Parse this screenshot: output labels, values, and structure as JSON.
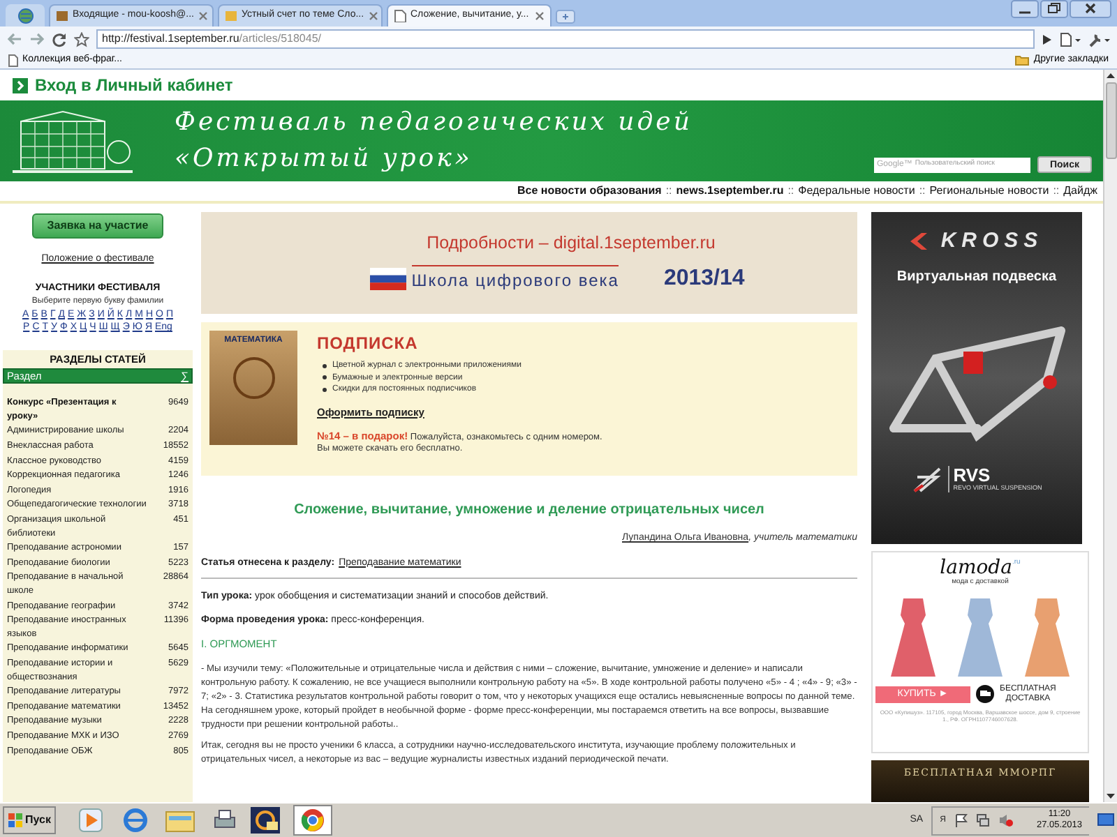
{
  "browser": {
    "tabs": [
      {
        "label": "Входящие - mou-koosh@...",
        "selected": false
      },
      {
        "label": "Устный счет по теме Сло...",
        "selected": false
      },
      {
        "label": "Сложение, вычитание, у...",
        "selected": true
      }
    ],
    "url_host": "http://festival.1september.ru",
    "url_path": "/articles/518045/",
    "bookmarks": [
      "Коллекция веб-фраг..."
    ],
    "other_bookmarks": "Другие закладки"
  },
  "site": {
    "login_link": "Вход в Личный кабинет",
    "title_line_1": "Фестиваль педагогических идей",
    "title_line_2": "«Открытый урок»",
    "search": {
      "brand": "Google™",
      "placeholder": "Пользовательский поиск",
      "button": "Поиск"
    },
    "news_links": [
      {
        "kind": "link",
        "label": "Все новости образования",
        "bold": true
      },
      {
        "kind": "separator",
        "label": "::"
      },
      {
        "kind": "link",
        "label": "news.1september.ru",
        "bold": true
      },
      {
        "kind": "separator",
        "label": "::"
      },
      {
        "kind": "link",
        "label": "Федеральные новости",
        "bold": false
      },
      {
        "kind": "separator",
        "label": "::"
      },
      {
        "kind": "link",
        "label": "Региональные новости",
        "bold": false
      },
      {
        "kind": "separator",
        "label": "::"
      },
      {
        "kind": "link",
        "label": "Дайдж",
        "bold": false
      }
    ]
  },
  "sidebar": {
    "apply_button": "Заявка на участие",
    "rules_link": "Положение о фестивале",
    "participants_title": "УЧАСТНИКИ ФЕСТИВАЛЯ",
    "participants_hint": "Выберите первую букву фамилии",
    "letter_rows": [
      [
        "А",
        "Б",
        "В",
        "Г",
        "Д",
        "Е",
        "Ж",
        "З",
        "И",
        "Й",
        "К",
        "Л",
        "М",
        "Н",
        "О",
        "П"
      ],
      [
        "Р",
        "С",
        "Т",
        "У",
        "Ф",
        "Х",
        "Ц",
        "Ч",
        "Ш",
        "Щ",
        "Э",
        "Ю",
        "Я",
        "Eng"
      ]
    ],
    "sections_title": "РАЗДЕЛЫ СТАТЕЙ",
    "columns": [
      "Раздел",
      "∑"
    ],
    "rows": [
      {
        "name": "Конкурс «Презентация к уроку»",
        "count": "9649",
        "bold": true
      },
      {
        "name": "Администрирование школы",
        "count": "2204",
        "bold": false
      },
      {
        "name": "Внеклассная работа",
        "count": "18552",
        "bold": false
      },
      {
        "name": "Классное руководство",
        "count": "4159",
        "bold": false
      },
      {
        "name": "Коррекционная педагогика",
        "count": "1246",
        "bold": false
      },
      {
        "name": "Логопедия",
        "count": "1916",
        "bold": false
      },
      {
        "name": "Общепедагогические технологии",
        "count": "3718",
        "bold": false
      },
      {
        "name": "Организация школьной библиотеки",
        "count": "451",
        "bold": false
      },
      {
        "name": "Преподавание астрономии",
        "count": "157",
        "bold": false
      },
      {
        "name": "Преподавание биологии",
        "count": "5223",
        "bold": false
      },
      {
        "name": "Преподавание в начальной школе",
        "count": "28864",
        "bold": false
      },
      {
        "name": "Преподавание географии",
        "count": "3742",
        "bold": false
      },
      {
        "name": "Преподавание иностранных языков",
        "count": "11396",
        "bold": false
      },
      {
        "name": "Преподавание информатики",
        "count": "5645",
        "bold": false
      },
      {
        "name": "Преподавание истории и обществознания",
        "count": "5629",
        "bold": false
      },
      {
        "name": "Преподавание литературы",
        "count": "7972",
        "bold": false
      },
      {
        "name": "Преподавание математики",
        "count": "13452",
        "bold": false
      },
      {
        "name": "Преподавание музыки",
        "count": "2228",
        "bold": false
      },
      {
        "name": "Преподавание МХК и ИЗО",
        "count": "2769",
        "bold": false
      },
      {
        "name": "Преподавание ОБЖ",
        "count": "805",
        "bold": false
      }
    ]
  },
  "promo": {
    "details": "Подробности – digital.1september.ru",
    "school": "Школа цифрового века",
    "year": "2013/14"
  },
  "subscription": {
    "cover_title": "МАТЕМАТИКА",
    "heading": "ПОДПИСКА",
    "bullets": [
      "Цветной журнал с электронными приложениями",
      "Бумажные и электронные версии",
      "Скидки для постоянных подписчиков"
    ],
    "link": "Оформить подписку",
    "gift": "**№14 – в подарок!** Пожалуйста, ознакомьтесь с одним номером.",
    "gift_line_2": "Вы можете скачать его бесплатно."
  },
  "article": {
    "title": "Сложение, вычитание, умножение и деление отрицательных чисел",
    "author": "Лупандина Ольга Ивановна",
    "author_role": ", учитель математики",
    "section_label": "Статья отнесена к разделу:",
    "section_link": "Преподавание математики",
    "facts": [
      "**Тип урока:** урок обобщения и систематизации знаний и способов действий.",
      "**Форма проведения урока:** пресс-конференция."
    ],
    "heading": "I. ОРГМОМЕНТ",
    "paragraphs": [
      "- Мы изучили тему: «Положительные и отрицательные числа и действия с ними – сложение, вычитание, умножение и деление» и написали контрольную работу. К сожалению, не все учащиеся выполнили контрольную работу на «5». В ходе контрольной работы получено «5» - 4 ; «4» - 9; «3» - 7; «2» - 3. Статистика результатов контрольной работы говорит о том, что у некоторых учащихся еще остались невыясненные вопросы по данной теме. На сегодняшнем уроке, который пройдет в необычной форме - форме пресс-конференции, мы постараемся ответить на все вопросы, вызвавшие трудности при решении контрольной работы..",
      "Итак, сегодня вы не просто ученики 6 класса, а сотрудники научно-исследовательского института, изучающие проблему положительных и отрицательных чисел, а некоторые из вас – ведущие журналисты известных изданий периодической печати."
    ]
  },
  "ads": {
    "kross": {
      "logo": "KROSS",
      "headline": "Виртуальная подвеска",
      "brand": "RVS",
      "tagline": "REVO VIRTUAL SUSPENSION"
    },
    "lamoda": {
      "logo": "lamoda",
      "logo_suffix": ".ru",
      "tagline": "мода с доставкой",
      "buy": "КУПИТЬ ►",
      "delivery_1": "БЕСПЛАТНАЯ",
      "delivery_2": "ДОСТАВКА",
      "legal": "ООО «Купишуз». 117105, город Москва, Варшавское шоссе, дом 9, строение 1., РФ. ОГРН1107746007628."
    },
    "game": {
      "headline": "БЕСПЛАТНАЯ ММОРПГ"
    }
  },
  "taskbar": {
    "start": "Пуск",
    "language": "SA",
    "tray_letter": "Я",
    "time": "11:20",
    "date": "27.05.2013"
  }
}
